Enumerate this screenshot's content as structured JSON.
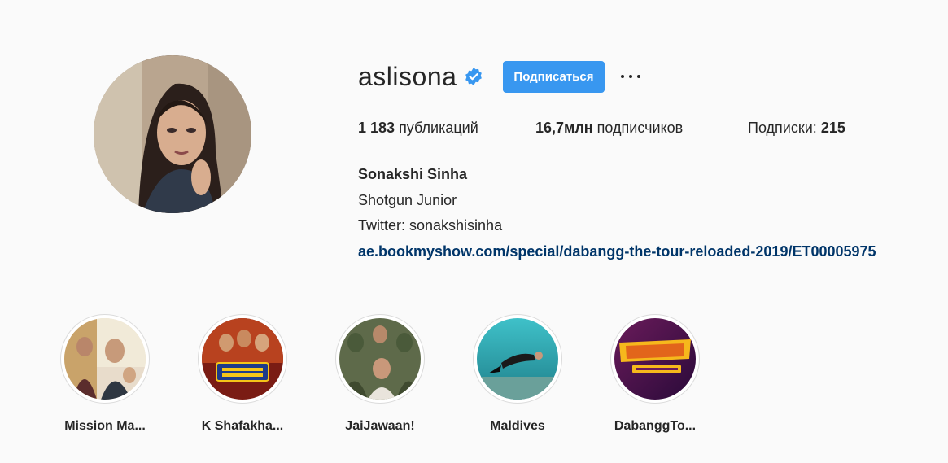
{
  "profile": {
    "username": "aslisona",
    "follow_label": "Подписаться",
    "stats": {
      "posts_value": "1 183",
      "posts_label": "публикаций",
      "followers_value": "16,7млн",
      "followers_label": "подписчиков",
      "following_label": "Подписки:",
      "following_value": "215"
    },
    "bio": {
      "full_name": "Sonakshi Sinha",
      "line1": "Shotgun Junior",
      "line2": "Twitter: sonakshisinha",
      "link": "ae.bookmyshow.com/special/dabangg-the-tour-reloaded-2019/ET00005975"
    }
  },
  "highlights": [
    {
      "label": "Mission Ma..."
    },
    {
      "label": "K Shafakha..."
    },
    {
      "label": "JaiJawaan!"
    },
    {
      "label": "Maldives"
    },
    {
      "label": "DabanggTo..."
    }
  ],
  "colors": {
    "accent": "#3897f0",
    "link": "#003569",
    "background": "#fafafa"
  }
}
